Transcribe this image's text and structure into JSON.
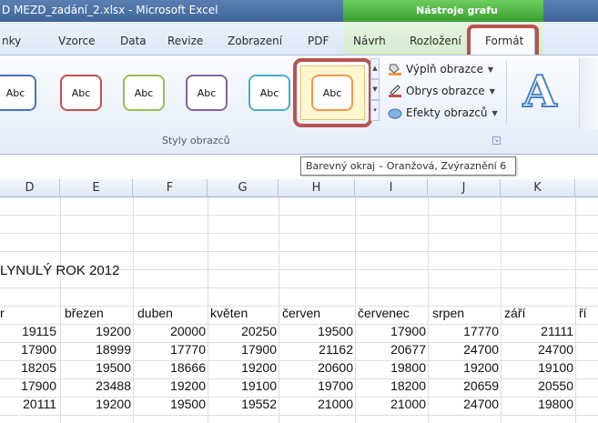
{
  "window": {
    "title": "D MEZD_zadání_2.xlsx - Microsoft Excel",
    "context_group": "Nástroje grafu"
  },
  "tabs": [
    {
      "label": "nky"
    },
    {
      "label": "Vzorce"
    },
    {
      "label": "Data"
    },
    {
      "label": "Revize"
    },
    {
      "label": "Zobrazení"
    },
    {
      "label": "PDF"
    },
    {
      "label": "Návrh"
    },
    {
      "label": "Rozložení"
    },
    {
      "label": "Formát",
      "active": true
    }
  ],
  "ribbon": {
    "styles_group_label": "Styly obrazců",
    "shape_styles": [
      {
        "label": "Abc",
        "color": "#4472c4"
      },
      {
        "label": "Abc",
        "color": "#c0504d"
      },
      {
        "label": "Abc",
        "color": "#9bbb59"
      },
      {
        "label": "Abc",
        "color": "#8064a2"
      },
      {
        "label": "Abc",
        "color": "#4bacc6"
      },
      {
        "label": "Abc",
        "color": "#f79646",
        "selected": true
      }
    ],
    "commands": {
      "fill": "Výplň obrazce",
      "outline": "Obrys obrazce",
      "effects": "Efekty obrazců"
    },
    "wordart_glyph": "A"
  },
  "tooltip": "Barevný okraj – Oranžová, Zvýraznění 6",
  "sheet": {
    "column_headers": [
      "D",
      "E",
      "F",
      "G",
      "H",
      "I",
      "J",
      "K"
    ],
    "heading": "LYNULÝ ROK 2012",
    "month_headers": [
      "r",
      "březen",
      "duben",
      "květen",
      "červen",
      "červenec",
      "srpen",
      "září",
      "ří"
    ],
    "rows": [
      [
        "19115",
        "19200",
        "20000",
        "20250",
        "19500",
        "17900",
        "17770",
        "21111"
      ],
      [
        "17900",
        "18999",
        "17770",
        "17900",
        "21162",
        "20677",
        "24700",
        "24700"
      ],
      [
        "18205",
        "19500",
        "18666",
        "19200",
        "20600",
        "19800",
        "19200",
        "19100"
      ],
      [
        "17900",
        "23488",
        "19200",
        "19100",
        "19700",
        "18200",
        "20659",
        "20550"
      ],
      [
        "20111",
        "19200",
        "19500",
        "19552",
        "21000",
        "21000",
        "24700",
        "19800"
      ]
    ]
  },
  "colors": {
    "title_bar": "#4a70a4",
    "context_green": "#4caf3f",
    "highlight_red": "#b85450"
  }
}
